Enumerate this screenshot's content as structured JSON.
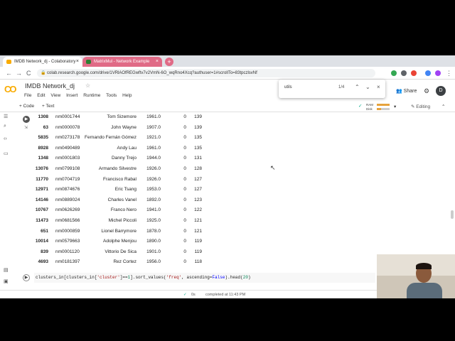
{
  "browser": {
    "tabs": [
      {
        "label": "IMDB Network_dj - Colaboratory",
        "close": "×"
      },
      {
        "label": "MatrixMul - Network Example",
        "close": "×"
      }
    ],
    "new_tab": "+",
    "url": "colab.research.google.com/drive/1VRlAOfREGwftv7v2VmN-6O_wqRno4Xcq?authuser=1#scrollTo=83tpczlsvNf",
    "nav": {
      "back": "←",
      "forward": "→",
      "reload": "C"
    }
  },
  "find_bar": {
    "query": "utils",
    "count": "1/4",
    "prev": "⌃",
    "next": "⌄",
    "close": "×"
  },
  "colab": {
    "logo": "CO",
    "title": "IMDB Network_dj",
    "star": "☆",
    "menu": [
      "File",
      "Edit",
      "View",
      "Insert",
      "Runtime",
      "Tools",
      "Help"
    ],
    "share": "Share",
    "avatar": "D"
  },
  "toolbar": {
    "code_btn": "+ Code",
    "text_btn": "+ Text",
    "ram": "RAM",
    "disk": "Disk",
    "editing": "Editing",
    "check": "✓"
  },
  "table": {
    "rows": [
      [
        "1308",
        "nm0001744",
        "Tom Sizemore",
        "1961.0",
        "0",
        "139"
      ],
      [
        "63",
        "nm0000078",
        "John Wayne",
        "1907.0",
        "0",
        "139"
      ],
      [
        "5835",
        "nm0273178",
        "Fernando Fernán Gómez",
        "1921.0",
        "0",
        "135"
      ],
      [
        "8928",
        "nm0490489",
        "Andy Lau",
        "1961.0",
        "0",
        "135"
      ],
      [
        "1348",
        "nm0001803",
        "Danny Trejo",
        "1944.0",
        "0",
        "131"
      ],
      [
        "13076",
        "nm0799108",
        "Armando Silvestre",
        "1926.0",
        "0",
        "128"
      ],
      [
        "11770",
        "nm0704719",
        "Francisco Rabal",
        "1926.0",
        "0",
        "127"
      ],
      [
        "12971",
        "nm0874676",
        "Eric Tsang",
        "1953.0",
        "0",
        "127"
      ],
      [
        "14146",
        "nm0889024",
        "Charles Vanel",
        "1892.0",
        "0",
        "123"
      ],
      [
        "10767",
        "nm0626269",
        "Franco Nero",
        "1941.0",
        "0",
        "122"
      ],
      [
        "11473",
        "nm0681566",
        "Michel Piccoli",
        "1925.0",
        "0",
        "121"
      ],
      [
        "651",
        "nm0000859",
        "Lionel Barrymore",
        "1878.0",
        "0",
        "121"
      ],
      [
        "10014",
        "nm0579663",
        "Adolphe Menjou",
        "1890.0",
        "0",
        "119"
      ],
      [
        "839",
        "nm0001120",
        "Vittorio De Sica",
        "1901.0",
        "0",
        "119"
      ],
      [
        "4693",
        "nm0181397",
        "Rez Cortez",
        "1956.0",
        "0",
        "118"
      ]
    ]
  },
  "code": {
    "p1": "clusters_in[clusters_in[",
    "s1": "'cluster'",
    "p2": "]==",
    "n1": "1",
    "p3": "].sort_values(",
    "s2": "'freq'",
    "p4": ", ascending=",
    "k1": "False",
    "p5": ").head(",
    "n2": "20",
    "p6": ")"
  },
  "status": {
    "check": "✓",
    "time": "0s",
    "message": "completed at 11:43 PM"
  },
  "colors": {
    "accent": "#f9ab00",
    "tab2": "#e06a86"
  }
}
